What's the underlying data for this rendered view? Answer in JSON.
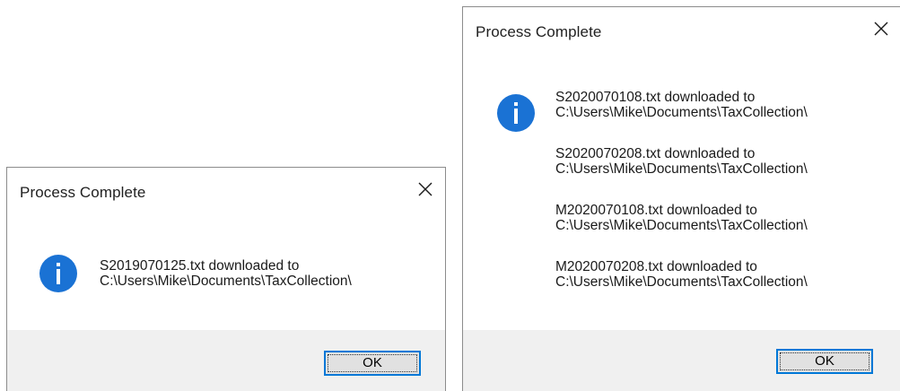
{
  "dialogs": [
    {
      "title": "Process Complete",
      "icon": "info-icon",
      "messages": [
        {
          "line1": "S2019070125.txt downloaded to",
          "line2": "C:\\Users\\Mike\\Documents\\TaxCollection\\"
        }
      ],
      "ok_label": "OK"
    },
    {
      "title": "Process Complete",
      "icon": "info-icon",
      "messages": [
        {
          "line1": "S2020070108.txt downloaded to",
          "line2": "C:\\Users\\Mike\\Documents\\TaxCollection\\"
        },
        {
          "line1": "S2020070208.txt downloaded to",
          "line2": "C:\\Users\\Mike\\Documents\\TaxCollection\\"
        },
        {
          "line1": "M2020070108.txt downloaded to",
          "line2": "C:\\Users\\Mike\\Documents\\TaxCollection\\"
        },
        {
          "line1": "M2020070208.txt downloaded to",
          "line2": "C:\\Users\\Mike\\Documents\\TaxCollection\\"
        }
      ],
      "ok_label": "OK"
    }
  ],
  "colors": {
    "accent": "#0078d7",
    "info_icon": "#1a72d4",
    "button_bar": "#f0f0f0"
  }
}
